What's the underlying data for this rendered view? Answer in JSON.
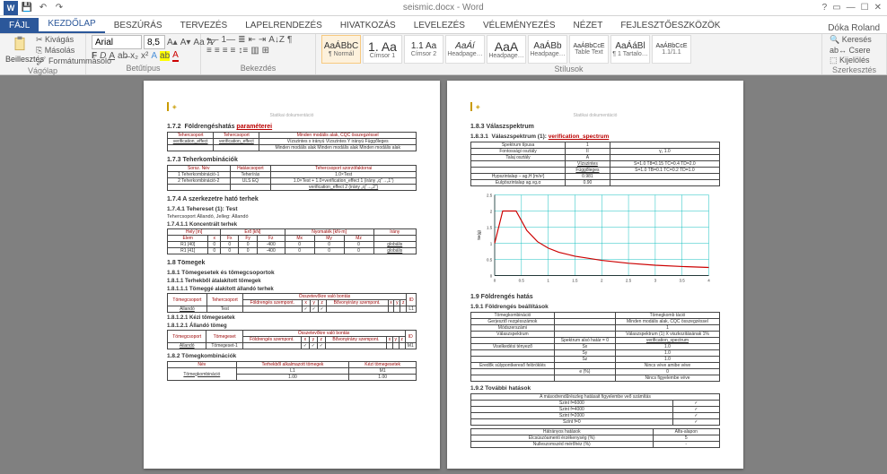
{
  "title_doc": "seismic.docx - Word",
  "user": "Dóka Roland",
  "tabs": {
    "file": "FÁJL",
    "home": "KEZDŐLAP",
    "insert": "BESZÚRÁS",
    "design": "TERVEZÉS",
    "layout": "LAPELRENDEZÉS",
    "references": "HIVATKOZÁS",
    "mailings": "LEVELEZÉS",
    "review": "VÉLEMÉNYEZÉS",
    "view": "NÉZET",
    "developer": "FEJLESZTŐESZKÖZÖK"
  },
  "clipboard": {
    "paste": "Beillesztés",
    "cut": "Kivágás",
    "copy": "Másolás",
    "painter": "Formátummásoló",
    "label": "Vágólap"
  },
  "font": {
    "name": "Arial",
    "size": "8,5",
    "label": "Betűtípus"
  },
  "para": {
    "label": "Bekezdés"
  },
  "styles": {
    "label": "Stílusok",
    "items": [
      {
        "prev": "AaÁBbC",
        "name": "¶ Normál",
        "cls": ""
      },
      {
        "prev": "1. Aa",
        "name": "Címsor 1",
        "cls": "big"
      },
      {
        "prev": "1.1 Aa",
        "name": "Címsor 2",
        "cls": ""
      },
      {
        "prev": "AaÁí",
        "name": "Headpage…",
        "cls": "ital"
      },
      {
        "prev": "AaA",
        "name": "Headpage…",
        "cls": "big"
      },
      {
        "prev": "AaÁBb",
        "name": "Headpage…",
        "cls": ""
      },
      {
        "prev": "AaÁBbCcE",
        "name": "Table Text",
        "cls": "sm"
      },
      {
        "prev": "AaÁáBl",
        "name": "¶ 1 Tartalo…",
        "cls": ""
      },
      {
        "prev": "AaÁBbCcE",
        "name": "1.1/1.1",
        "cls": "sm"
      }
    ]
  },
  "editing": {
    "find": "Keresés",
    "replace": "Csere",
    "select": "Kijelölés",
    "label": "Szerkesztés"
  },
  "doc": {
    "left": {
      "footer": "Statikai dokumentáció",
      "s172": "1.7.2  Földrengéshatás paraméterei",
      "s172_link": "paraméterei",
      "s172_tbl": {
        "h": [
          "Tehercsoport",
          "Tehercsoport",
          ""
        ],
        "r1": [
          "verification_effect",
          "verification_effect",
          "Minden modális alak, CQC összegzéssel"
        ],
        "r2": [
          "",
          "",
          "Vízszintes x irányú   Vízszintes Y irányú   Függőleges"
        ],
        "r3": [
          "",
          "",
          "Minden modális alak Minden modális alak Minden modális alak"
        ]
      },
      "s173": "1.7.3  Teherkombinációk",
      "s173_tbl": {
        "h": [
          "Sorsz. Név",
          "Hatáscsoport",
          "Tehercsoport szorzófaktorrai"
        ],
        "r1": [
          "1 Teherkombináció-1",
          "Teherírás",
          "1.0×Test"
        ],
        "r2": [
          "2 Teherkombináció-2",
          "ULS EQ",
          "1.0×Test + 1.0×verification_effect 1 (irány „q”→„1”)"
        ],
        "r3": [
          "",
          "",
          "verification_effect 2 (irány „q”→„2”)"
        ]
      },
      "s174": "1.7.4  A szerkezetre ható terhek",
      "s1741": "1.7.4.1 Tehereset (1): Test",
      "s1741_sub": "Tehercsoport Állandó, Jelleg: Állandó",
      "s17411": "1.7.4.1.1 Koncentrált terhek",
      "s17411_tbl": {
        "h": [
          "",
          "Hely [m]",
          "",
          "",
          "Nyomaték [kN·m]",
          "",
          "Irány"
        ],
        "h2": [
          "Elem",
          "x",
          "Fx",
          "Fy",
          "Fz",
          "Mx",
          "My",
          "Mz",
          ""
        ],
        "r1": [
          "R1 [40]",
          "0",
          "0",
          "0",
          "-400",
          "0",
          "0",
          "0",
          "globális"
        ],
        "r2": [
          "R1 [41]",
          "0",
          "0",
          "0",
          "-400",
          "0",
          "0",
          "0",
          "globális"
        ]
      },
      "s18": "1.8  Tömegek",
      "s181": "1.8.1  Tömegesetek és tömegcsoportok",
      "s1811": "1.8.1.1  Terhekből átalakított tömegek",
      "s18111": "1.8.1.1.1 Tömeggé alakított állandó terhek",
      "s18111_tbl": {
        "h": [
          "Tömegcsoport",
          "Tehercsoport",
          "Összetevőkre való bontás",
          "",
          "",
          "ID"
        ],
        "h2": [
          "",
          "",
          "Földrengés szempont.",
          "x",
          "y",
          "z",
          "Bővonyirány szempont.",
          "x",
          "y",
          "z",
          ""
        ],
        "r": [
          "Állandó",
          "Test",
          "",
          "✓",
          "✓",
          "✓",
          "",
          "",
          "",
          "",
          "L1"
        ]
      },
      "s18121": "1.8.1.2.1 Kézi tömegesetek",
      "s18122": "1.8.1.2.1 Állandó tömeg",
      "s18122_tbl": {
        "h": [
          "Tömegcsoport",
          "Tömegeset",
          "Összetevőkre való bontás",
          "",
          "",
          "ID"
        ],
        "h2": [
          "",
          "",
          "Földrengés szempont.",
          "x",
          "y",
          "z",
          "Bővonyirány szempont.",
          "x",
          "y",
          "z",
          ""
        ],
        "r": [
          "Állandó",
          "Tömegeset-1",
          "",
          "✓",
          "✓",
          "✓",
          "",
          "",
          "",
          "",
          "M1"
        ]
      },
      "s182": "1.8.2  Tömegkombinációk",
      "s182_tbl": {
        "h": [
          "Név",
          "Terhekből alkalmazott tömegek",
          "Kézi tömegesetek"
        ],
        "r": [
          "Tömegkombináció",
          "L1",
          "M1"
        ],
        "r2": [
          "",
          "1.00",
          "1.00"
        ]
      }
    },
    "right": {
      "footer": "Statikai dokumentáció",
      "s183": "1.8.3  Válaszspektrum",
      "s1831": "1.8.3.1  Válaszspektrum (1): verification_spectrum",
      "s1831_link": "verification_spectrum",
      "s1831_tbl": {
        "r1": [
          "Spektrum típusa",
          "1",
          "",
          ""
        ],
        "r2": [
          "Fontossági osztály",
          "II",
          "γ₁ 1.0"
        ],
        "r3": [
          "Talaj osztály",
          "A",
          "",
          ""
        ],
        "r4": [
          "",
          "Vízszintes",
          "S=1.0 T8=0.15 TC=0.4 TD=2.0"
        ],
        "r5": [
          "",
          "Függőleges",
          "S=1.0 TB=0.1 TC=0.2 TD=1.0"
        ],
        "r6": [
          "Hypszintalap – ag,H [m/s²]",
          "0.981",
          "",
          ""
        ],
        "r7": [
          "Eulgöszintalap ag,νg,α",
          "0.90",
          "",
          ""
        ]
      },
      "s19": "1.9  Földrengés hatás",
      "s191": "1.9.1  Földrengés beállítások",
      "s191_tbl": {
        "r1": [
          "Tömegkombináció",
          "",
          "Tömegkomb táció"
        ],
        "r2": [
          "Gerjesztő rezgésszámok",
          "",
          "Minden modális alak, CQC összegzéssel"
        ],
        "r3": [
          "Módszerszámi",
          "",
          "1"
        ],
        "r4": [
          "Válaszspektrum",
          "",
          "Válaszspektrum (1) X viszkozitásának 1%"
        ],
        "r5": [
          "",
          "",
          "Spektrum alsó határ = 0",
          "verification_spectrum"
        ],
        "r6": [
          "Viselkedési tényező",
          "",
          "Sx",
          "1.0"
        ],
        "r7": [
          "",
          "",
          "Sy",
          "1.0"
        ],
        "r8": [
          "",
          "",
          "Sz",
          "1.0"
        ],
        "r9": [
          "Eredők súlypontkereső felöröklés",
          "",
          "Nincs véve amibe véve"
        ],
        "r10": [
          "",
          "",
          "e (%)",
          "0"
        ],
        "r11": [
          "",
          "",
          "Nincs figyelembe véve"
        ]
      },
      "s192": "1.9.2  További hatások",
      "s192_tbl": {
        "h": [
          "A másodrendűrészleg hatásait figyelembe veő számítás",
          ""
        ],
        "r1": [
          "Szint f=6000",
          "✓"
        ],
        "r2": [
          "Szint f=4000",
          "✓"
        ],
        "r3": [
          "Szint f=2000",
          "✓"
        ],
        "r4": [
          "Szint f=0",
          "✓"
        ]
      },
      "s192b_tbl": {
        "r1": [
          "Hátrányos hatások",
          "Alfa-alapon"
        ],
        "r2": [
          "Elcsúszóamenti érzékenység (%)",
          "5"
        ],
        "r3": [
          "Nulleszomszéd mérőhéz (%)",
          "-"
        ]
      }
    }
  },
  "chart_data": {
    "type": "line",
    "xlabel": "T",
    "ylabel": "Se(g)",
    "xlim": [
      0,
      4
    ],
    "ylim": [
      0,
      2.5
    ],
    "x_ticks": [
      0,
      0.5,
      1,
      1.5,
      2,
      2.5,
      3,
      3.5,
      4
    ],
    "y_ticks": [
      0,
      0.5,
      1,
      1.5,
      2,
      2.5
    ],
    "series": [
      {
        "name": "spectrum",
        "color": "#c00",
        "x": [
          0,
          0.15,
          0.4,
          0.6,
          0.8,
          1.0,
          1.2,
          1.5,
          2.0,
          2.5,
          3.0,
          3.5,
          4.0
        ],
        "y": [
          1.0,
          2.0,
          2.0,
          1.4,
          1.05,
          0.85,
          0.72,
          0.6,
          0.47,
          0.38,
          0.32,
          0.28,
          0.25
        ]
      }
    ]
  }
}
